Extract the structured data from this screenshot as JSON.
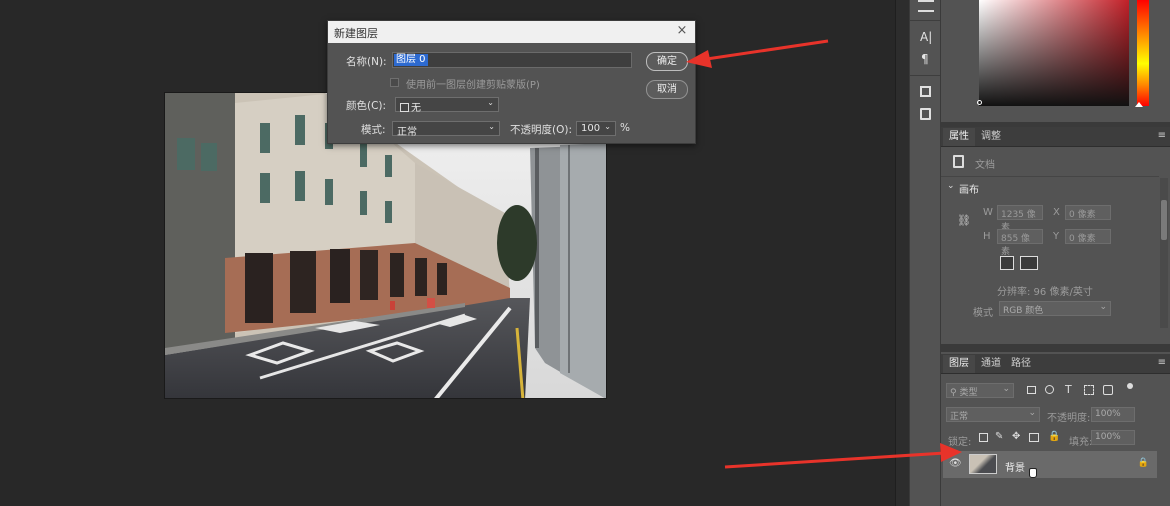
{
  "dialog": {
    "title": "新建图层",
    "close": "×",
    "name_label": "名称(N):",
    "name_value": "图层 0",
    "clip_label": "使用前一图层创建剪贴蒙版(P)",
    "color_label": "颜色(C):",
    "color_value": "无",
    "mode_label": "模式:",
    "mode_value": "正常",
    "opacity_label": "不透明度(O):",
    "opacity_value": "100",
    "percent": "%",
    "ok_label": "确定",
    "cancel_label": "取消"
  },
  "properties": {
    "tabs": [
      "属性",
      "调整"
    ],
    "doc_label": "文档",
    "canvas_label": "画布",
    "w_label": "W",
    "w_value": "1235 像素",
    "h_label": "H",
    "h_value": "855 像素",
    "x_label": "X",
    "x_value": "0 像素",
    "y_label": "Y",
    "y_value": "0 像素",
    "resolution": "分辨率: 96 像素/英寸",
    "mode_label": "模式",
    "mode_value": "RGB 颜色"
  },
  "layers": {
    "tabs": [
      "图层",
      "通道",
      "路径"
    ],
    "filter_label": "类型",
    "blend_mode": "正常",
    "opacity_label": "不透明度:",
    "opacity_value": "100%",
    "lock_label": "锁定:",
    "fill_label": "填充:",
    "fill_value": "100%",
    "layer_name": "背景"
  },
  "colors": {
    "accent_arrow": "#e8332a",
    "panel_bg": "#535353",
    "workspace_bg": "#282828"
  }
}
